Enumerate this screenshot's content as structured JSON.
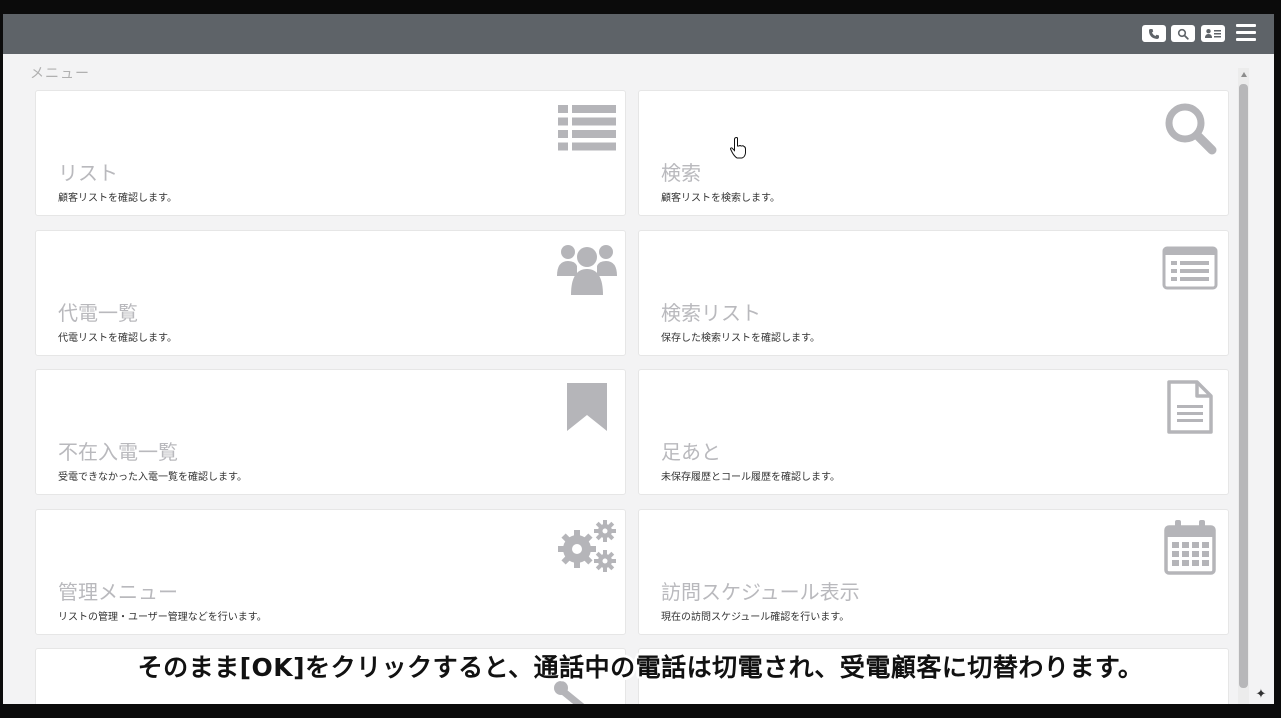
{
  "menu": {
    "title": "メニュー",
    "items": [
      {
        "title": "リスト",
        "desc": "顧客リストを確認します。",
        "icon": "list-icon"
      },
      {
        "title": "検索",
        "desc": "顧客リストを検索します。",
        "icon": "search-icon"
      },
      {
        "title": "代電一覧",
        "desc": "代電リストを確認します。",
        "icon": "users-icon"
      },
      {
        "title": "検索リスト",
        "desc": "保存した検索リストを確認します。",
        "icon": "list-alt-icon"
      },
      {
        "title": "不在入電一覧",
        "desc": "受電できなかった入電一覧を確認します。",
        "icon": "bookmark-icon"
      },
      {
        "title": "足あと",
        "desc": "未保存履歴とコール履歴を確認します。",
        "icon": "document-icon"
      },
      {
        "title": "管理メニュー",
        "desc": "リストの管理・ユーザー管理などを行います。",
        "icon": "gears-icon"
      },
      {
        "title": "訪問スケジュール表示",
        "desc": "現在の訪問スケジュール確認を行います。",
        "icon": "calendar-icon"
      }
    ]
  },
  "toolbar": {
    "icons": [
      "phone-icon",
      "search-icon",
      "contact-card-icon",
      "hamburger-menu-icon"
    ]
  },
  "scroll_corner_symbol": "✦",
  "caption": "そのまま[OK]をクリックすると、通話中の電話は切電され、受電顧客に切替わります。",
  "colors": {
    "topbar": "#5e6368",
    "background": "#f3f3f4",
    "card_title": "#b9b9bd",
    "icon": "#b5b5b9"
  }
}
